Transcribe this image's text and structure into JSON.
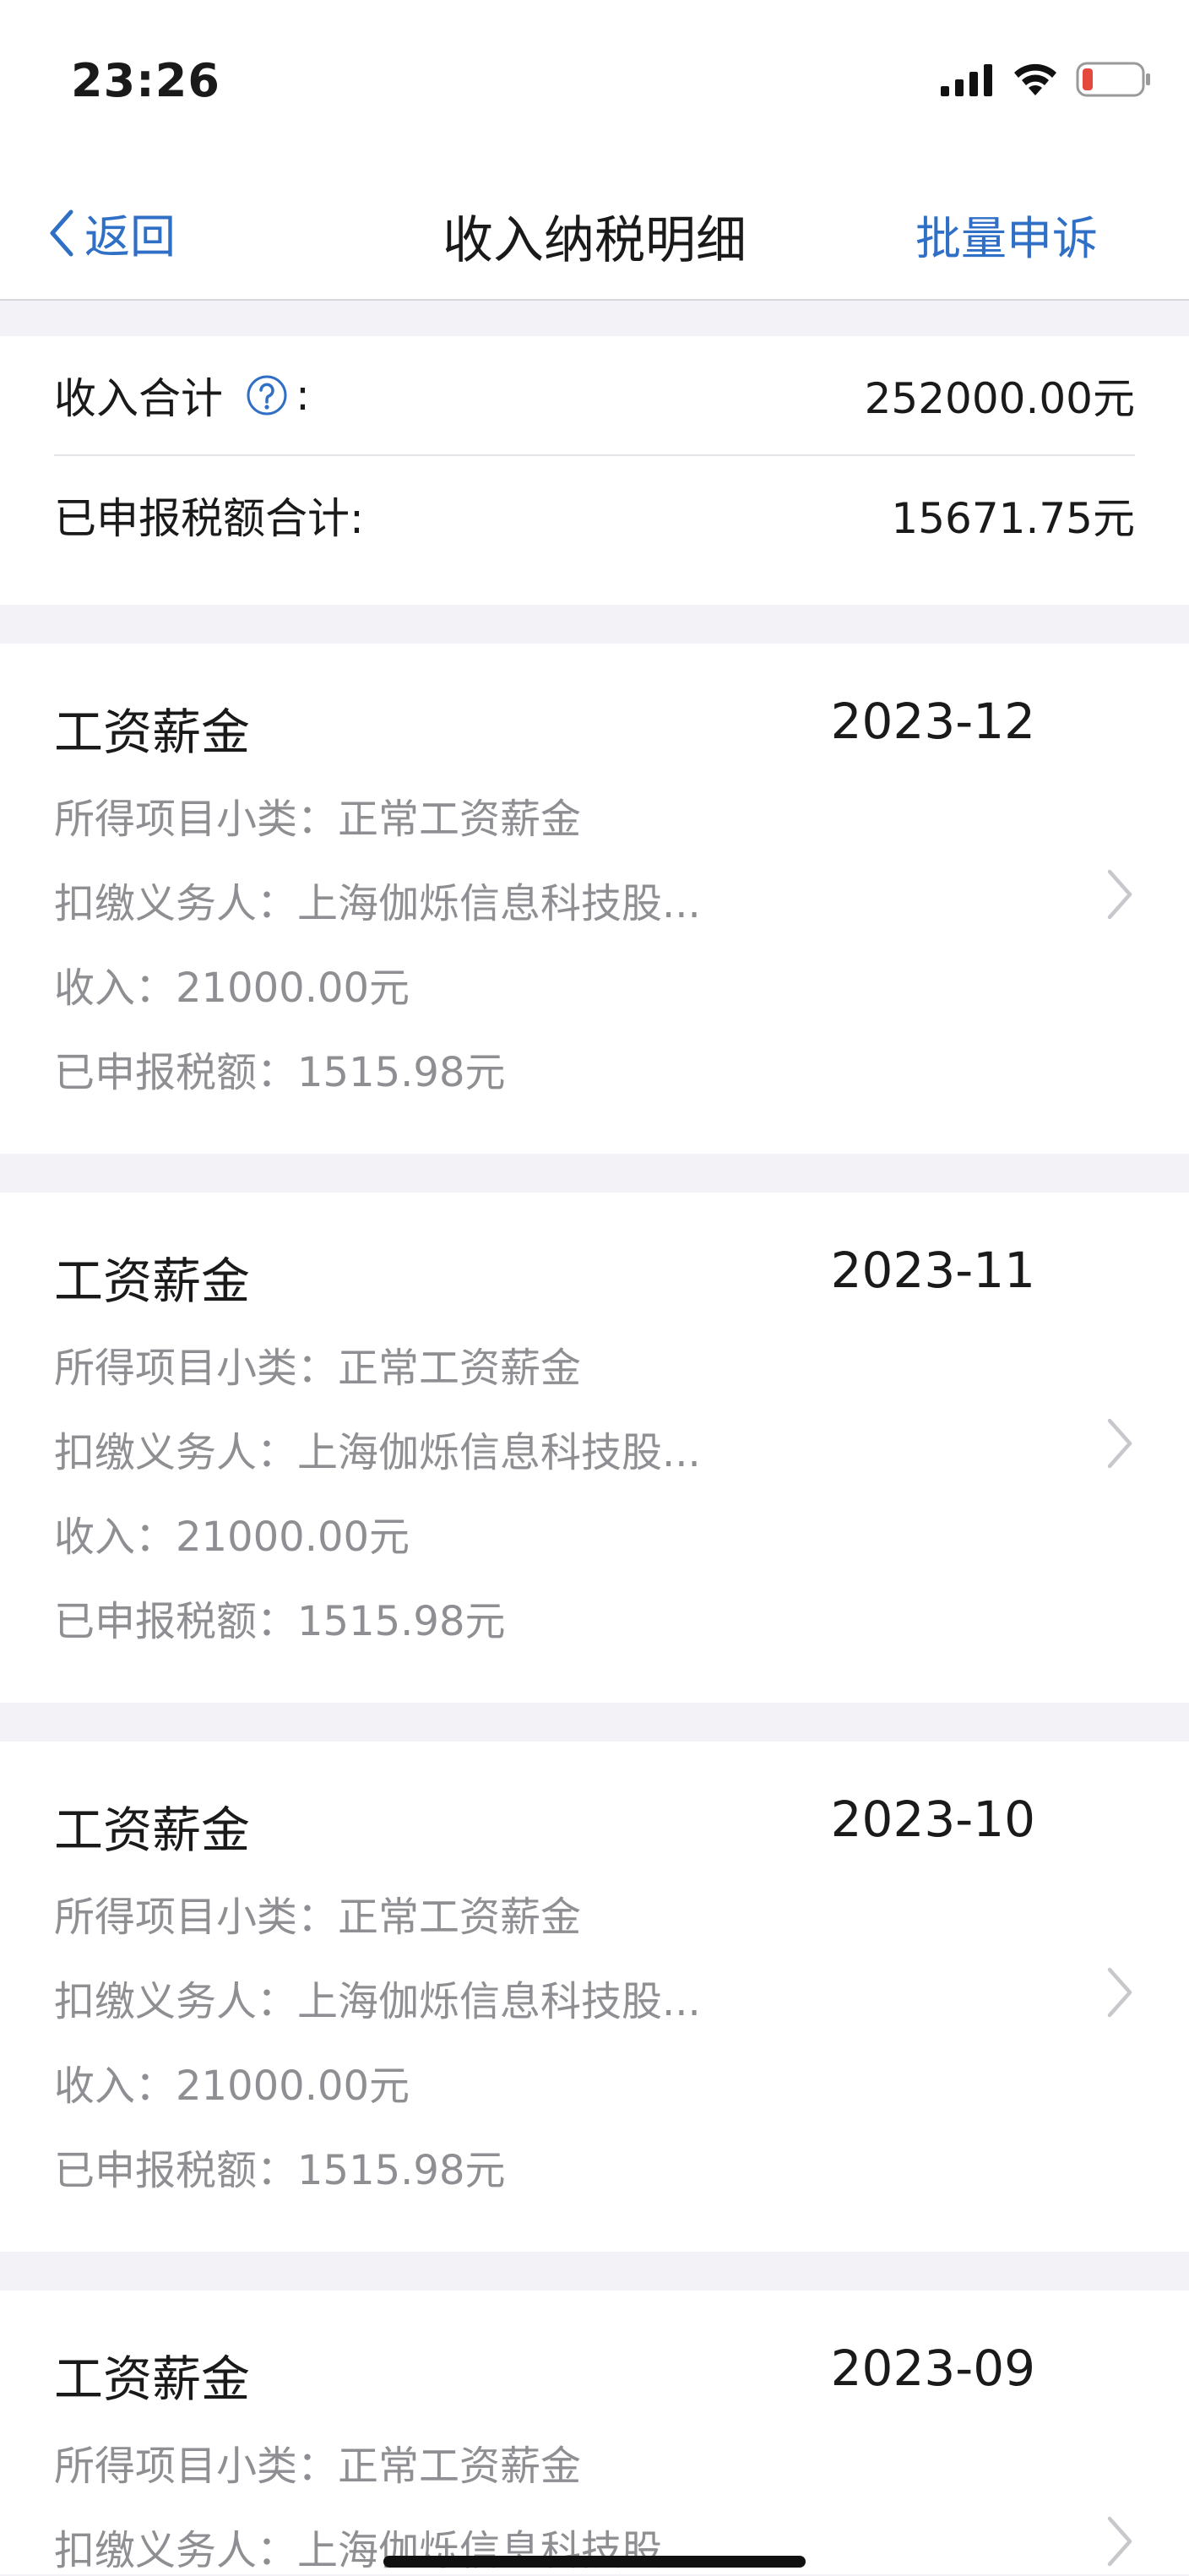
{
  "status": {
    "time": "23:26"
  },
  "nav": {
    "back_label": "返回",
    "title": "收入纳税明细",
    "action_label": "批量申诉"
  },
  "summary": {
    "income_label": "收入合计",
    "income_colon": ":",
    "income_value": "252000.00元",
    "tax_label": "已申报税额合计:",
    "tax_value": "15671.75元"
  },
  "records": [
    {
      "title": "工资薪金",
      "period": "2023-12",
      "subcategory": "所得项目小类：正常工资薪金",
      "withholder": "扣缴义务人：上海伽烁信息科技股...",
      "income": "收入：21000.00元",
      "tax": "已申报税额：1515.98元"
    },
    {
      "title": "工资薪金",
      "period": "2023-11",
      "subcategory": "所得项目小类：正常工资薪金",
      "withholder": "扣缴义务人：上海伽烁信息科技股...",
      "income": "收入：21000.00元",
      "tax": "已申报税额：1515.98元"
    },
    {
      "title": "工资薪金",
      "period": "2023-10",
      "subcategory": "所得项目小类：正常工资薪金",
      "withholder": "扣缴义务人：上海伽烁信息科技股...",
      "income": "收入：21000.00元",
      "tax": "已申报税额：1515.98元"
    },
    {
      "title": "工资薪金",
      "period": "2023-09",
      "subcategory": "所得项目小类：正常工资薪金",
      "withholder": "扣缴义务人：上海伽烁信息科技股"
    }
  ],
  "colors": {
    "accent": "#2f6fc6",
    "battery_low": "#e5483c",
    "secondary_text": "#8e8e93"
  }
}
